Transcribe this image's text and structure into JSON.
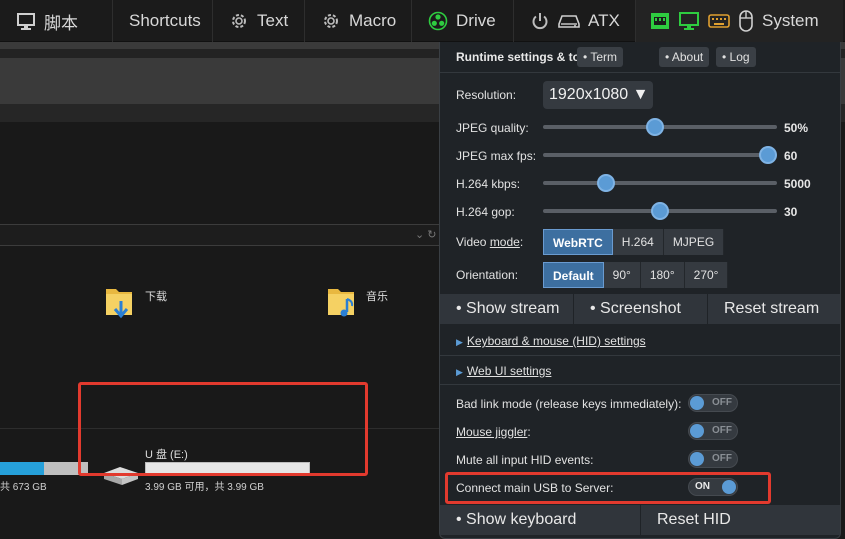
{
  "topbar": {
    "items": [
      {
        "label": "脚本",
        "icon": "monitor-icon"
      },
      {
        "label": "Shortcuts",
        "icon": ""
      },
      {
        "label": "Text",
        "icon": "gear-icon"
      },
      {
        "label": "Macro",
        "icon": "gear-icon"
      },
      {
        "label": "Drive",
        "icon": "drive-biohazard-icon"
      },
      {
        "label": "ATX",
        "icon": "power-icon"
      },
      {
        "label": "System",
        "icon": "mouse-icon"
      }
    ],
    "status_colors": {
      "ethernet": "#2ecc40",
      "display": "#2ecc40",
      "keyboard": "#e0a030"
    }
  },
  "remote": {
    "folders": [
      {
        "label": "下载",
        "icon": "download-folder-icon"
      },
      {
        "label": "音乐",
        "icon": "music-folder-icon"
      }
    ],
    "left_drive_text": "共 673 GB",
    "left_drive_fill": 0.5,
    "drive": {
      "name": "U 盘 (E:)",
      "detail": "3.99 GB 可用，共 3.99 GB",
      "used_fraction": 0.0
    }
  },
  "panel": {
    "title": "Runtime settings & tools",
    "pills": [
      "• Term",
      "• About",
      "• Log"
    ],
    "resolution": {
      "label": "Resolution:",
      "value": "1920x1080 ▼"
    },
    "sliders": [
      {
        "label": "JPEG quality:",
        "value": "50%",
        "fraction": 0.48
      },
      {
        "label": "JPEG max fps:",
        "value": "60",
        "fraction": 0.96
      },
      {
        "label": "H.264 kbps:",
        "value": "5000",
        "fraction": 0.27
      },
      {
        "label": "H.264 gop:",
        "value": "30",
        "fraction": 0.5
      }
    ],
    "video_mode": {
      "label": "Video ",
      "label_u": "mode",
      "label_tail": ":",
      "options": [
        "WebRTC",
        "H.264",
        "MJPEG"
      ],
      "active": 0
    },
    "orientation": {
      "label": "Orientation:",
      "options": [
        "Default",
        "90°",
        "180°",
        "270°"
      ],
      "active": 0
    },
    "stream_buttons": [
      "• Show stream",
      "• Screenshot",
      "Reset stream"
    ],
    "sections": [
      "Keyboard & mouse (HID) settings",
      "Web UI settings"
    ],
    "toggles": [
      {
        "label": "Bad link mode (release keys immediately):",
        "state": "OFF"
      },
      {
        "label": "Mouse jiggler",
        "tail": ":",
        "state": "OFF"
      },
      {
        "label": "Mute all input HID events:",
        "state": "OFF"
      },
      {
        "label": "Connect main USB to Server:",
        "state": "ON"
      }
    ],
    "bottom_buttons": [
      "• Show keyboard",
      "Reset HID"
    ]
  },
  "highlight_color": "#e23a2e"
}
